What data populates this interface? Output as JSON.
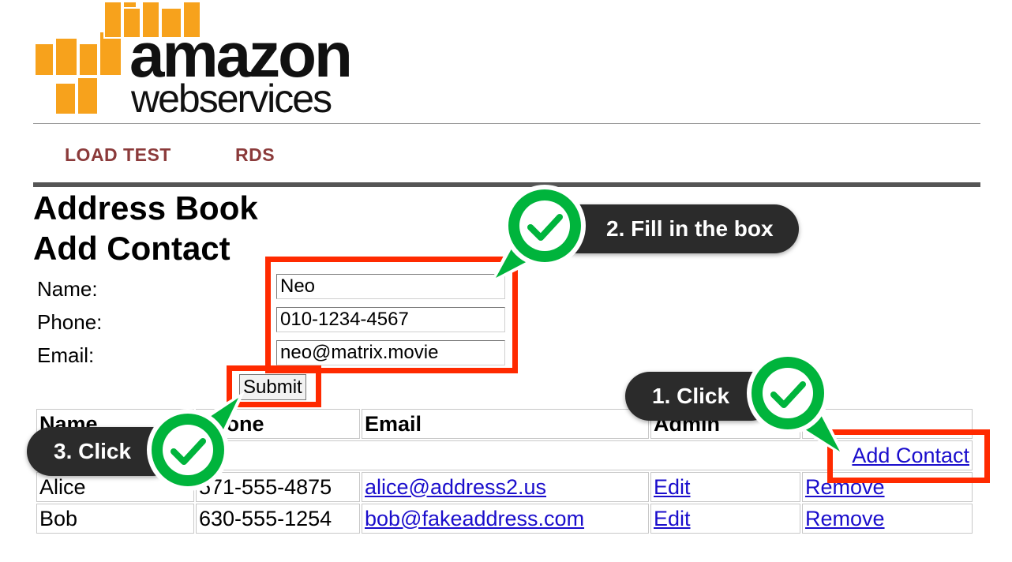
{
  "logo": {
    "word1": "amazon",
    "word2": "webservices"
  },
  "nav": {
    "load_test": "LOAD TEST",
    "rds": "RDS"
  },
  "headings": {
    "address_book": "Address Book",
    "add_contact": "Add Contact"
  },
  "form": {
    "name_label": "Name:",
    "phone_label": "Phone:",
    "email_label": "Email:",
    "name_value": "Neo",
    "phone_value": "010-1234-4567",
    "email_value": "neo@matrix.movie",
    "submit_label": "Submit"
  },
  "table": {
    "headers": {
      "name": "Name",
      "phone": "Phone",
      "email": "Email",
      "admin": "Admin"
    },
    "add_contact_link": "Add Contact",
    "rows": [
      {
        "name": "Alice",
        "phone": "571-555-4875",
        "email": "alice@address2.us",
        "edit": "Edit",
        "remove": "Remove"
      },
      {
        "name": "Bob",
        "phone": "630-555-1254",
        "email": "bob@fakeaddress.com",
        "edit": "Edit",
        "remove": "Remove"
      }
    ]
  },
  "annotations": {
    "step1": "1. Click",
    "step2": "2. Fill in the box",
    "step3": "3. Click"
  },
  "colors": {
    "highlight": "#ff2a00",
    "badge_green": "#00b43c",
    "callout_bg": "#2b2b2b",
    "nav_text": "#8b3a3a",
    "logo_orange": "#f7a21c",
    "link": "#1a0dcc"
  },
  "icons": {
    "badge": "check-icon"
  }
}
